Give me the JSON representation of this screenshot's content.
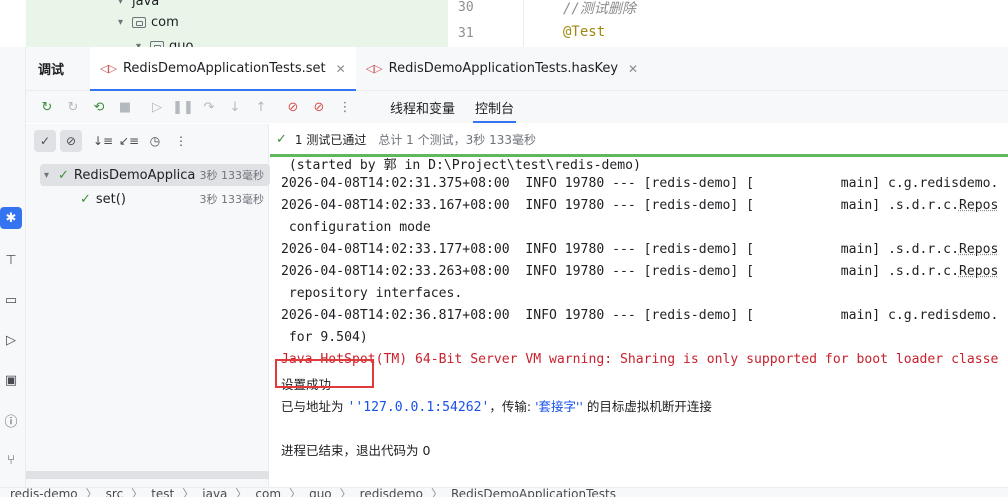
{
  "project_tree": {
    "rows": [
      {
        "label": "java",
        "expanded": true
      },
      {
        "label": "com",
        "expanded": true
      },
      {
        "label": "guo",
        "expanded": true
      }
    ]
  },
  "editor": {
    "lines": [
      {
        "number": "30",
        "code": "//测试删除"
      },
      {
        "number": "31",
        "code": "@Test"
      }
    ],
    "colors": {
      "comment": "#8c8c8c",
      "annotation": "#9e880d"
    }
  },
  "debug_panel": {
    "title": "调试",
    "tabs": [
      {
        "label": "RedisDemoApplicationTests.set",
        "active": true
      },
      {
        "label": "RedisDemoApplicationTests.hasKey",
        "active": false
      }
    ],
    "view_tabs": [
      {
        "label": "线程和变量",
        "active": false
      },
      {
        "label": "控制台",
        "active": true
      }
    ]
  },
  "test_tree": {
    "root": {
      "label": "RedisDemoApplica",
      "duration": "3秒 133毫秒"
    },
    "children": [
      {
        "label": "set()",
        "duration": "3秒 133毫秒"
      }
    ]
  },
  "status": {
    "passed": "1 测试已通过",
    "summary": "总计 1 个测试，3秒 133毫秒",
    "color": "#5fb85f"
  },
  "console": {
    "lines": [
      " (started by 郭 in D:\\Project\\test\\redis-demo)",
      "2026-04-08T14:02:31.375+08:00  INFO 19780 --- [redis-demo] [           main] c.g.redisdemo.",
      "2026-04-08T14:02:33.167+08:00  INFO 19780 --- [redis-demo] [           main] .s.d.r.c.",
      " configuration mode",
      "2026-04-08T14:02:33.177+08:00  INFO 19780 --- [redis-demo] [           main] .s.d.r.c.",
      "2026-04-08T14:02:33.263+08:00  INFO 19780 --- [redis-demo] [           main] .s.d.r.c.",
      " repository interfaces.",
      "2026-04-08T14:02:36.817+08:00  INFO 19780 --- [redis-demo] [           main] c.g.redisdemo.",
      " for 9.504)"
    ],
    "repos_word": "Repos",
    "warning": "Java HotSpot(TM) 64-Bit Server VM warning: Sharing is only supported for boot loader classe",
    "success_text": "设置成功",
    "disconnect_prefix": "已与地址为 ",
    "disconnect_addr": "''127.0.0.1:54262'",
    "disconnect_mid": "，传输: ",
    "disconnect_transport": "'套接字''",
    "disconnect_suffix": " 的目标虚拟机断开连接",
    "exit_text": "进程已结束，退出代码为 0",
    "warning_color": "#c7222d",
    "highlight_color": "#e03a3a"
  },
  "breadcrumbs": [
    "redis-demo",
    "src",
    "test",
    "java",
    "com",
    "guo",
    "redisdemo",
    "RedisDemoApplicationTests"
  ]
}
